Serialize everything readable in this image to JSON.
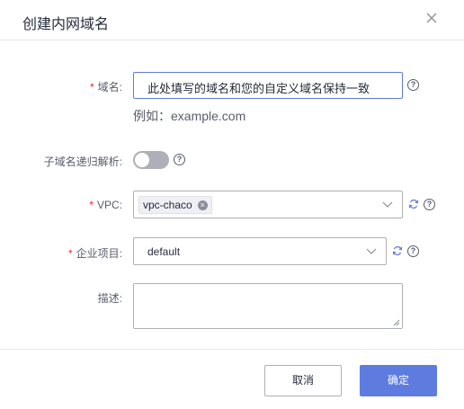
{
  "dialog": {
    "title": "创建内网域名",
    "close_icon": "close-icon"
  },
  "form": {
    "domain": {
      "required_mark": "*",
      "label": "域名:",
      "value": "此处填写的域名和您的自定义域名保持一致",
      "example": "例如：example.com",
      "help_icon": "help-icon"
    },
    "recursive": {
      "label": "子域名递归解析:",
      "enabled": false,
      "help_icon": "help-icon"
    },
    "vpc": {
      "required_mark": "*",
      "label": "VPC:",
      "selected_tag": "vpc-chaco",
      "remove_icon": "close-circle-icon",
      "dropdown_icon": "chevron-down-icon",
      "refresh_icon": "refresh-icon",
      "help_icon": "help-icon"
    },
    "enterprise_project": {
      "required_mark": "*",
      "label": "企业项目:",
      "value": "default",
      "dropdown_icon": "chevron-down-icon",
      "refresh_icon": "refresh-icon",
      "help_icon": "help-icon"
    },
    "description": {
      "label": "描述:",
      "value": "",
      "resize_icon": "resize-handle-icon"
    }
  },
  "footer": {
    "cancel_label": "取消",
    "ok_label": "确定"
  },
  "colors": {
    "primary": "#5e7ce0",
    "required": "#f5222d",
    "toggle_off": "#adb0b8",
    "border": "#adb0b8"
  }
}
